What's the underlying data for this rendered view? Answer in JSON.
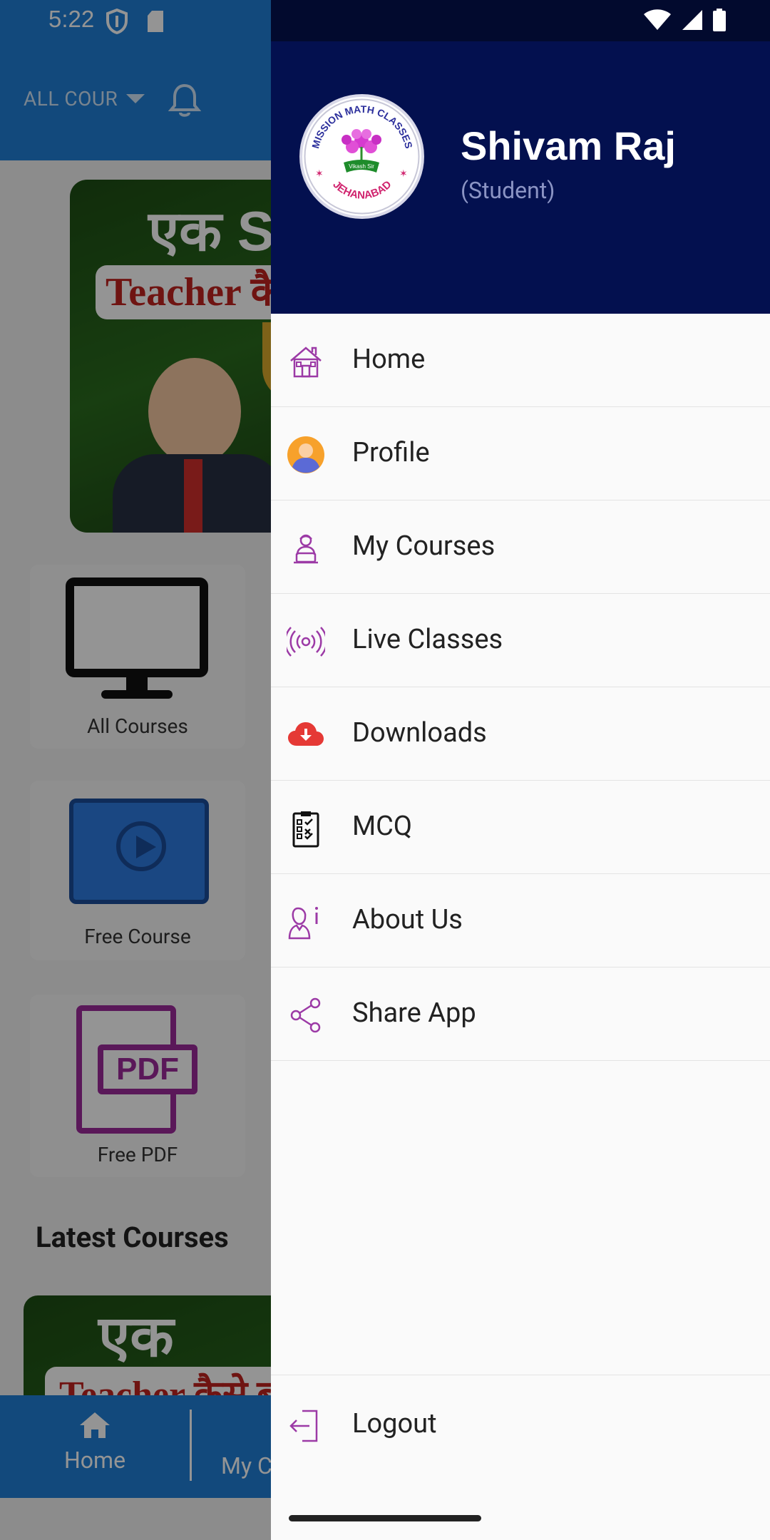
{
  "status_bar": {
    "time": "5:22"
  },
  "background_app": {
    "course_filter_label": "ALL COUR",
    "banner_hindi_text": "एक S",
    "banner_pill_text": "Teacher कै",
    "cards": [
      {
        "label": "All Courses"
      },
      {
        "label": "Free Course"
      },
      {
        "label": "Free PDF",
        "tag": "PDF"
      }
    ],
    "latest_courses_title": "Latest Courses",
    "banner2_hindi_text": "एक Succ",
    "banner2_pill_text": "Teacher कैसे ब",
    "bottom_nav": [
      {
        "label": "Home"
      },
      {
        "label": "My C"
      }
    ]
  },
  "drawer": {
    "profile": {
      "name": "Shivam Raj",
      "role": "(Student)",
      "logo_text_top": "MISSION MATH CLASSES",
      "logo_text_bottom": "JEHANABAD",
      "logo_ribbon": "Vikash Sir"
    },
    "menu": [
      {
        "label": "Home",
        "icon": "home-icon"
      },
      {
        "label": "Profile",
        "icon": "profile-icon"
      },
      {
        "label": "My Courses",
        "icon": "courses-icon"
      },
      {
        "label": "Live Classes",
        "icon": "live-broadcast-icon"
      },
      {
        "label": "Downloads",
        "icon": "cloud-download-icon"
      },
      {
        "label": "MCQ",
        "icon": "checklist-icon"
      },
      {
        "label": "About Us",
        "icon": "about-user-icon"
      },
      {
        "label": "Share App",
        "icon": "share-icon"
      }
    ],
    "logout_label": "Logout"
  },
  "colors": {
    "app_bar": "#1f7fd6",
    "drawer_header": "#03104f",
    "role_text": "#8b94c4",
    "icon_purple": "#9c3aa6",
    "download_red": "#e53935",
    "profile_orange": "#f7a12b"
  }
}
